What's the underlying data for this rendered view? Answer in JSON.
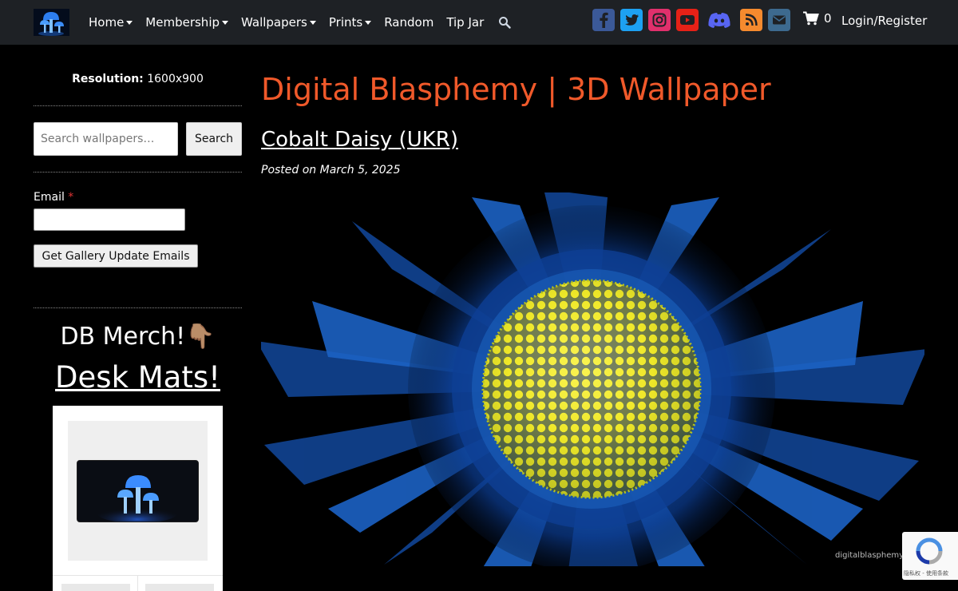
{
  "nav": {
    "items": [
      {
        "label": "Home",
        "dropdown": true
      },
      {
        "label": "Membership",
        "dropdown": true
      },
      {
        "label": "Wallpapers",
        "dropdown": true
      },
      {
        "label": "Prints",
        "dropdown": true
      },
      {
        "label": "Random",
        "dropdown": false
      },
      {
        "label": "Tip Jar",
        "dropdown": false
      }
    ],
    "search_icon": "search-icon",
    "socials": [
      {
        "name": "facebook-icon",
        "color": "#3b5998"
      },
      {
        "name": "twitter-icon",
        "color": "#1da1f2"
      },
      {
        "name": "instagram-icon",
        "color": "#e1306c"
      },
      {
        "name": "youtube-icon",
        "color": "#e62117"
      },
      {
        "name": "discord-icon",
        "color": "#5865f2"
      },
      {
        "name": "rss-icon",
        "color": "#f58a2e"
      },
      {
        "name": "email-icon",
        "color": "#3d6a8f"
      }
    ],
    "cart_count": "0",
    "login_label": "Login/Register"
  },
  "sidebar": {
    "resolution_label": "Resolution:",
    "resolution_value": "1600x900",
    "search_placeholder": "Search wallpapers…",
    "search_button": "Search",
    "email_label": "Email",
    "email_required": "*",
    "updates_button": "Get Gallery Update Emails",
    "merch_title": "DB Merch!👇🏽",
    "merch_link": "Desk Mats!"
  },
  "main": {
    "site_title": "Digital Blasphemy | 3D Wallpaper",
    "post_title": "Cobalt Daisy (UKR)",
    "post_date": "Posted on March 5, 2025",
    "watermark": "digitalblasphemy."
  },
  "recaptcha": {
    "links": "隐私权 - 使用条款"
  },
  "colors": {
    "accent": "#f0592a",
    "navbar": "#1e2125"
  }
}
